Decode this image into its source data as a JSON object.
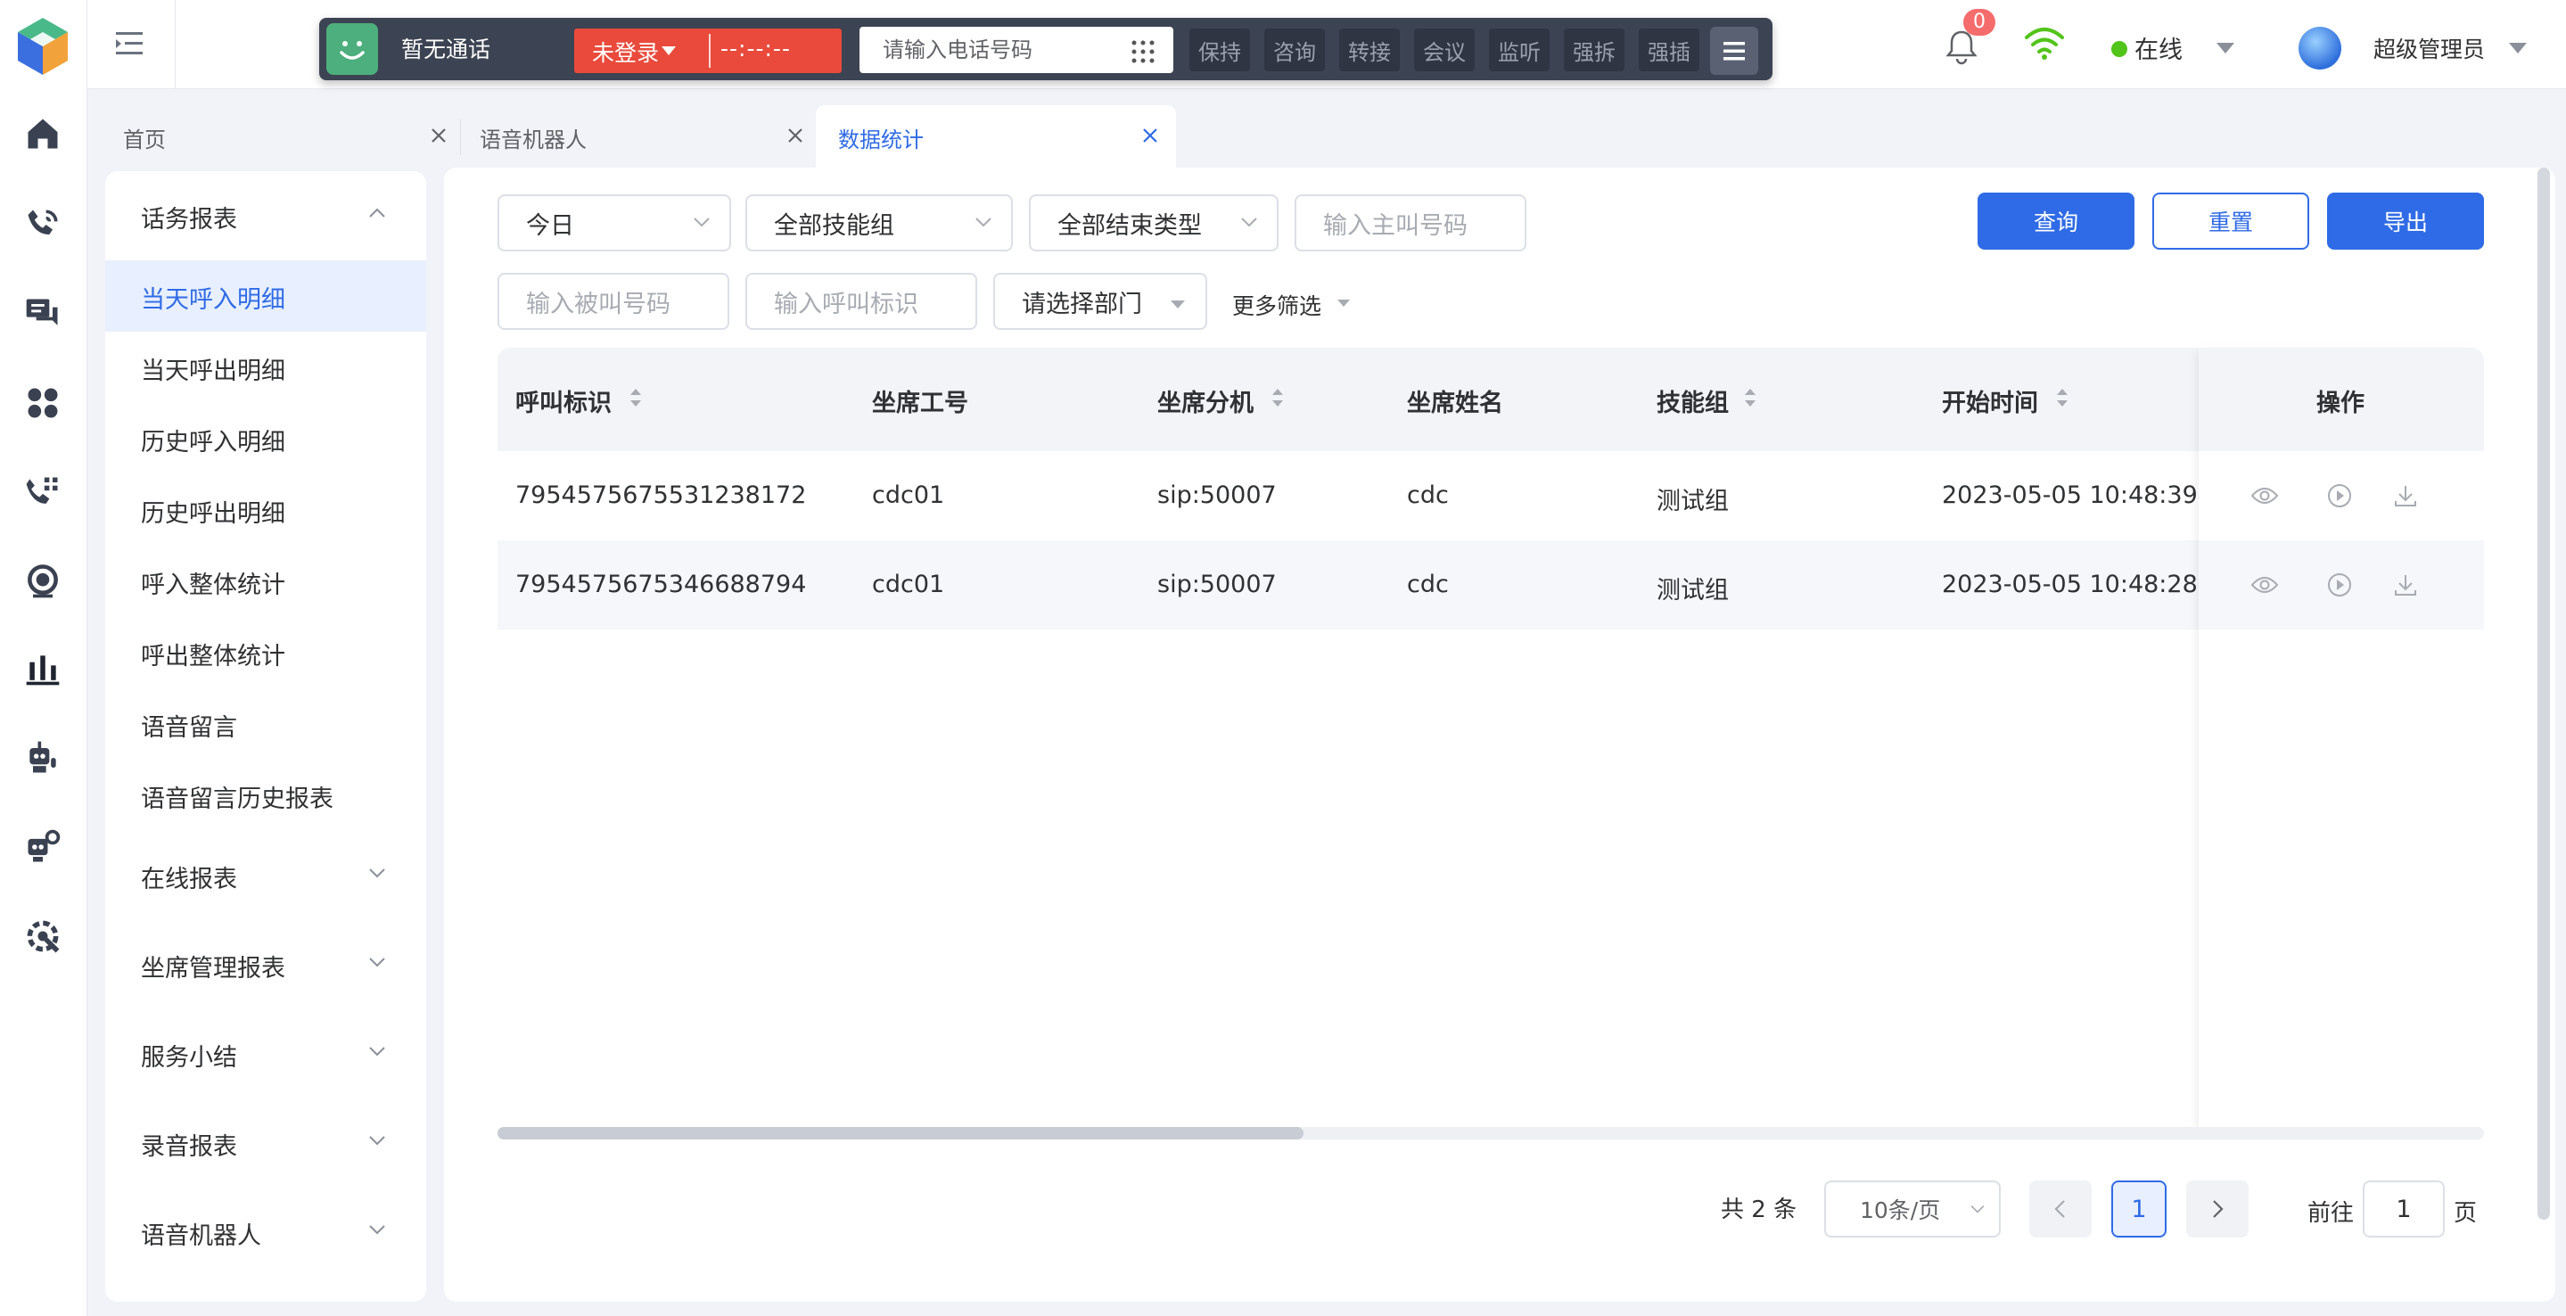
{
  "rail": {
    "icons": [
      "logo-icon",
      "home-icon",
      "phone-call-icon",
      "chat-icon",
      "apps-icon",
      "dialpad-phone-icon",
      "record-icon",
      "bar-chart-icon",
      "robot-voice-icon",
      "robot-settings-icon",
      "tools-icon"
    ]
  },
  "phonebar": {
    "status": "暂无通话",
    "login": "未登录",
    "timer": "--:--:--",
    "phone_placeholder": "请输入电话号码",
    "controls": [
      "保持",
      "咨询",
      "转接",
      "会议",
      "监听",
      "强拆",
      "强插"
    ]
  },
  "header": {
    "notification_count": "0",
    "presence": "在线",
    "user": "超级管理员"
  },
  "tabs": [
    {
      "label": "首页"
    },
    {
      "label": "语音机器人"
    },
    {
      "label": "数据统计"
    }
  ],
  "subnav": {
    "groups": [
      {
        "label": "话务报表"
      },
      {
        "label": "在线报表"
      },
      {
        "label": "坐席管理报表"
      },
      {
        "label": "服务小结"
      },
      {
        "label": "录音报表"
      },
      {
        "label": "语音机器人"
      }
    ],
    "items": [
      "当天呼入明细",
      "当天呼出明细",
      "历史呼入明细",
      "历史呼出明细",
      "呼入整体统计",
      "呼出整体统计",
      "语音留言",
      "语音留言历史报表"
    ]
  },
  "filters": {
    "date": "今日",
    "skill_group": "全部技能组",
    "end_type": "全部结束类型",
    "caller_placeholder": "输入主叫号码",
    "callee_placeholder": "输入被叫号码",
    "callid_placeholder": "输入呼叫标识",
    "department": "请选择部门",
    "more": "更多筛选",
    "query": "查询",
    "reset": "重置",
    "export": "导出"
  },
  "table": {
    "columns": [
      "呼叫标识",
      "坐席工号",
      "坐席分机",
      "坐席姓名",
      "技能组",
      "开始时间",
      "操作"
    ],
    "rows": [
      [
        "7954575675531238172",
        "cdc01",
        "sip:50007",
        "cdc",
        "测试组",
        "2023-05-05 10:48:39"
      ],
      [
        "7954575675346688794",
        "cdc01",
        "sip:50007",
        "cdc",
        "测试组",
        "2023-05-05 10:48:28"
      ]
    ]
  },
  "pagination": {
    "total": "共 2 条",
    "page_size": "10条/页",
    "current": "1",
    "goto_prefix": "前往",
    "goto_value": "1",
    "goto_suffix": "页"
  },
  "colors": {
    "primary": "#2f6be6",
    "danger": "#e94a3b",
    "online": "#52c41a",
    "phonebar": "#3c4352"
  }
}
